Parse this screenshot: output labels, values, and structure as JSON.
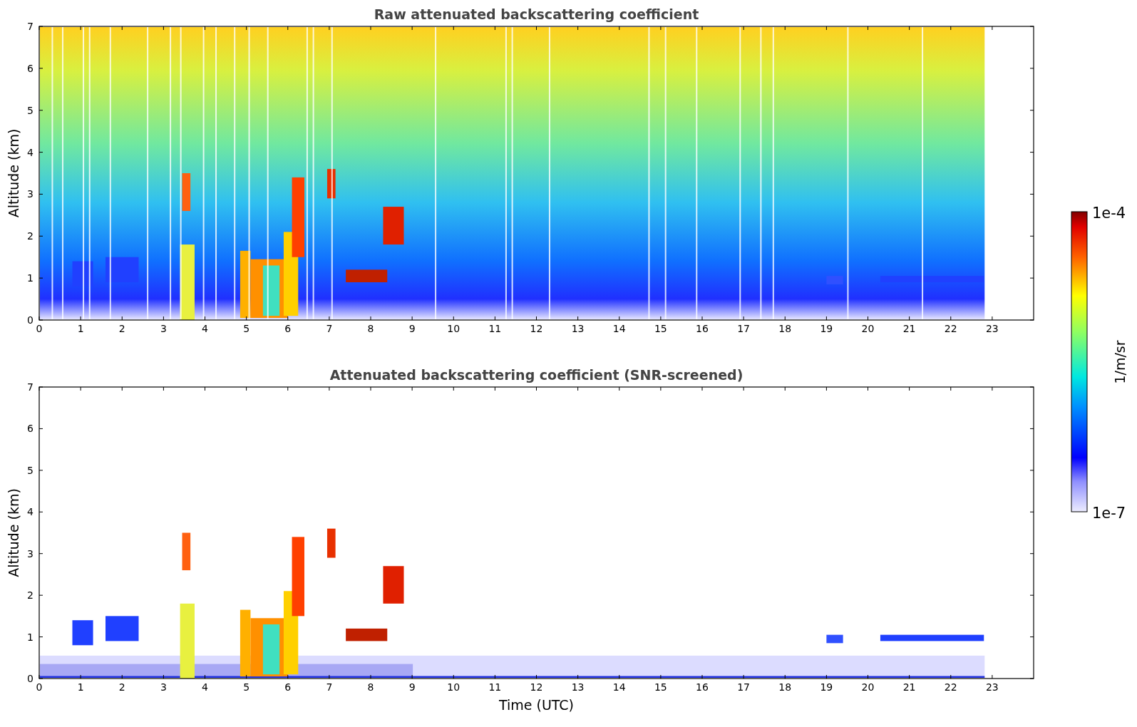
{
  "panels": [
    {
      "title": "Raw attenuated backscattering coefficient",
      "ylabel": "Altitude (km)",
      "yticks": [
        "7",
        "6",
        "5",
        "4",
        "3",
        "2",
        "1",
        "0"
      ],
      "xticks": [
        "0",
        "1",
        "2",
        "3",
        "4",
        "5",
        "6",
        "7",
        "8",
        "9",
        "10",
        "11",
        "12",
        "13",
        "14",
        "15",
        "16",
        "17",
        "18",
        "19",
        "20",
        "21",
        "22",
        "23"
      ],
      "kind": "raw"
    },
    {
      "title": "Attenuated backscattering coefficient (SNR-screened)",
      "ylabel": "Altitude (km)",
      "yticks": [
        "7",
        "6",
        "5",
        "4",
        "3",
        "2",
        "1",
        "0"
      ],
      "xticks": [
        "0",
        "1",
        "2",
        "3",
        "4",
        "5",
        "6",
        "7",
        "8",
        "9",
        "10",
        "11",
        "12",
        "13",
        "14",
        "15",
        "16",
        "17",
        "18",
        "19",
        "20",
        "21",
        "22",
        "23"
      ],
      "xlabel": "Time (UTC)",
      "kind": "screened"
    }
  ],
  "colorbar": {
    "max_label": "1e-4",
    "min_label": "1e-7",
    "unit": "1/m/sr"
  }
}
